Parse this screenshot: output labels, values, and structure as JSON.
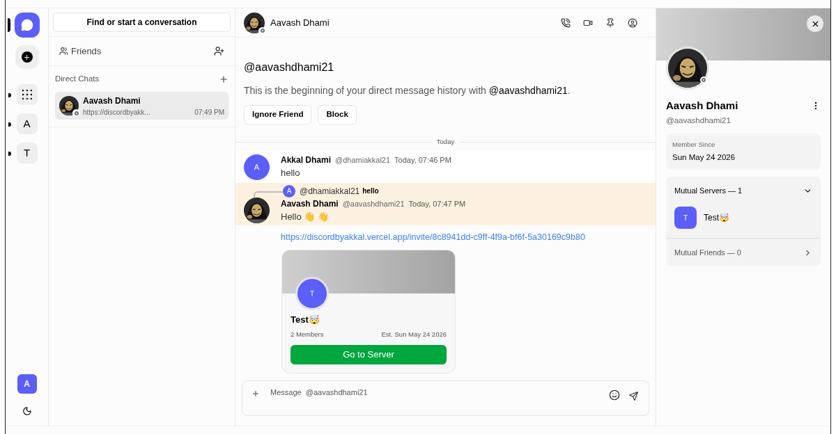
{
  "rail": {
    "home": {
      "selected": true
    },
    "servers": [
      {
        "kind": "grid",
        "unread": true
      },
      {
        "kind": "letter",
        "label": "A",
        "unread": true
      },
      {
        "kind": "letter",
        "label": "T",
        "unread": true
      }
    ],
    "user_initial": "A"
  },
  "chats": {
    "search": "Find or start a conversation",
    "friends": "Friends",
    "section": "Direct Chats",
    "items": [
      {
        "name": "Aavash Dhami",
        "preview": "https://discordbyakk...",
        "time": "07:49 PM",
        "selected": true
      }
    ]
  },
  "header": {
    "name": "Aavash Dhami"
  },
  "intro": {
    "handle": "@aavashdhami21",
    "text": "This is the beginning of your direct message history with **@aavashdhami21**.",
    "buttons": [
      "Ignore Friend",
      "Block"
    ]
  },
  "divider": "Today",
  "messages": [
    {
      "kind": "letter",
      "initial": "A",
      "name": "Akkal Dhami",
      "handle": "@dhamiakkal21",
      "time": "Today, 07:46 PM",
      "text": "hello",
      "highlighted": false
    },
    {
      "name": "Aavash Dhami",
      "handle": "@aavashdhami21",
      "time": "Today, 07:47 PM",
      "text": "Hello 👋 👋",
      "highlighted": true,
      "reply": {
        "initial": "A",
        "handle": "@dhamiakkal21",
        "text": "hello"
      },
      "link": "https://discordbyakkal.vercel.app/invite/8c8941dd-c9ff-4f9a-bf6f-5a30169c9b80",
      "invite": {
        "initial": "T",
        "name": "Test🤯",
        "members": "2 Members",
        "established": "Est. Sun May 24 2026",
        "button": "Go to Server"
      }
    }
  ],
  "composer": {
    "placeholder": "Message  @aavashdhami21"
  },
  "profile": {
    "name": "Aavash Dhami",
    "handle": "@aavashdhami21",
    "member_label": "Member Since",
    "member_date": "Sun May 24 2026",
    "mutual_servers": {
      "label": "Mutual Servers — 1",
      "expanded": true,
      "items": [
        {
          "initial": "T",
          "name": "Test🤯"
        }
      ]
    },
    "mutual_friends": {
      "label": "Mutual Friends — 0",
      "expanded": false
    }
  }
}
